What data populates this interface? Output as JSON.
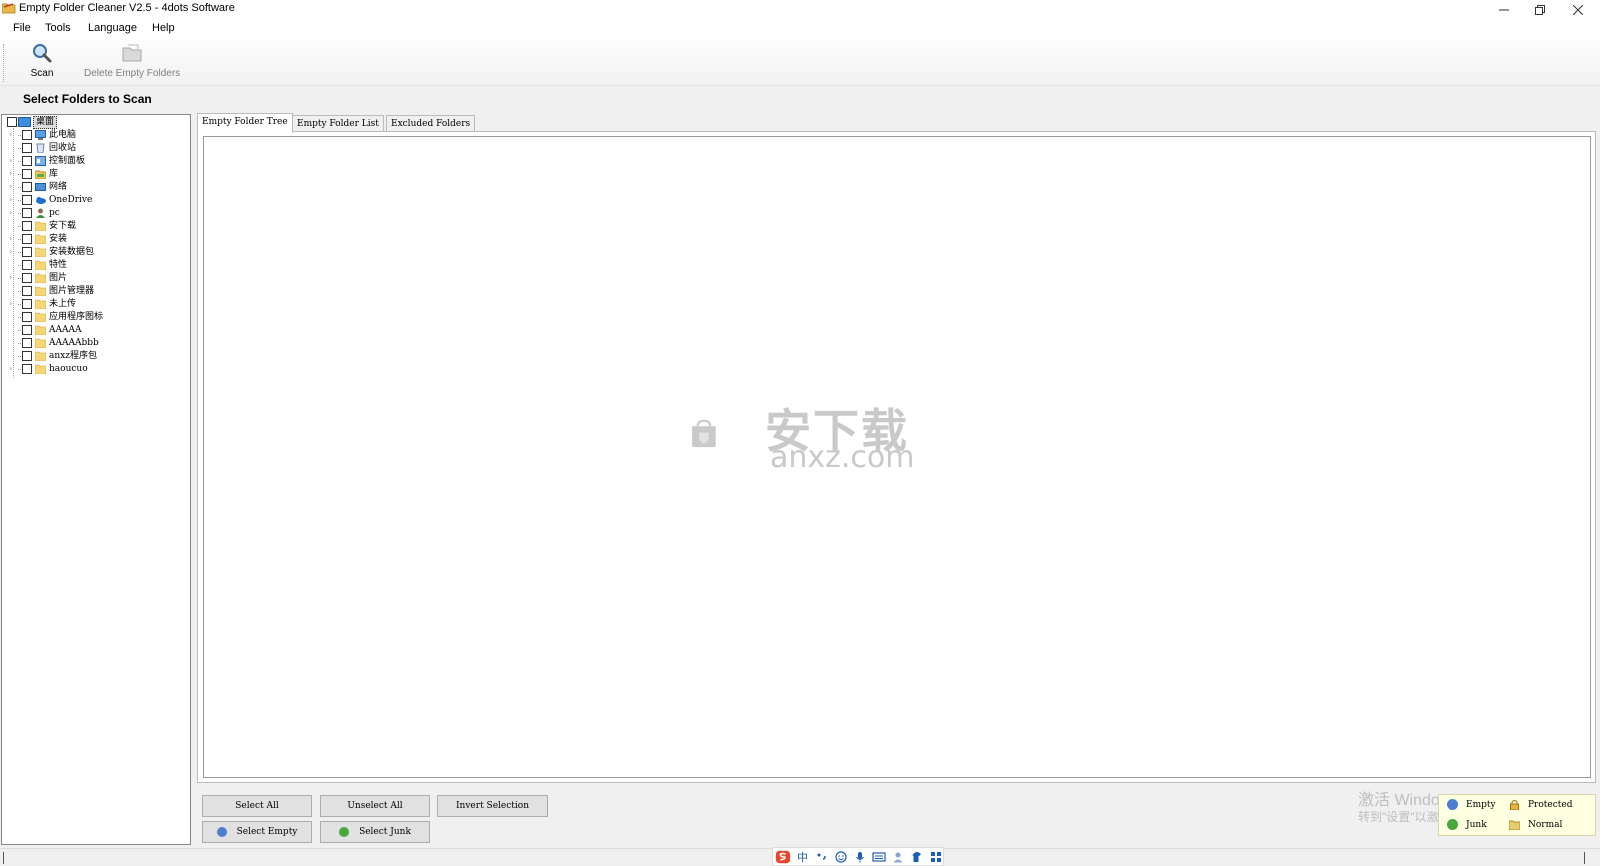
{
  "window": {
    "title": "Empty Folder Cleaner V2.5 - 4dots Software"
  },
  "menu": {
    "file": "File",
    "tools": "Tools",
    "language": "Language",
    "help": "Help"
  },
  "toolbar": {
    "scan": "Scan",
    "delete": "Delete Empty Folders"
  },
  "left_panel": {
    "header": "Select Folders to Scan"
  },
  "tree": {
    "root": "桌面",
    "items": [
      "此电脑",
      "回收站",
      "控制面板",
      "库",
      "网络",
      "OneDrive",
      "pc",
      "安下载",
      "安装",
      "安装数据包",
      "特性",
      "图片",
      "图片管理器",
      "未上传",
      "应用程序图标",
      "AAAAA",
      "AAAAAbbb",
      "anxz程序包",
      "haoucuo"
    ]
  },
  "tabs": [
    "Empty Folder Tree",
    "Empty Folder List",
    "Excluded Folders"
  ],
  "buttons": {
    "select_all": "Select All",
    "unselect_all": "Unselect All",
    "invert_selection": "Invert Selection",
    "select_empty": "Select Empty",
    "select_junk": "Select Junk"
  },
  "legend": {
    "empty": "Empty",
    "protected": "Protected",
    "junk": "Junk",
    "normal": "Normal"
  },
  "watermark": {
    "text": "安下载",
    "sub": "anxz.com"
  },
  "activation": {
    "line1": "激活 Windows",
    "line2": "转到\"设置\"以激活 Windows。"
  },
  "ime": {
    "lang": "中"
  },
  "colors": {
    "empty": "#4a7fd0",
    "junk": "#47a83c",
    "protected": "#e4b43c",
    "normal": "#e9cc6e"
  }
}
